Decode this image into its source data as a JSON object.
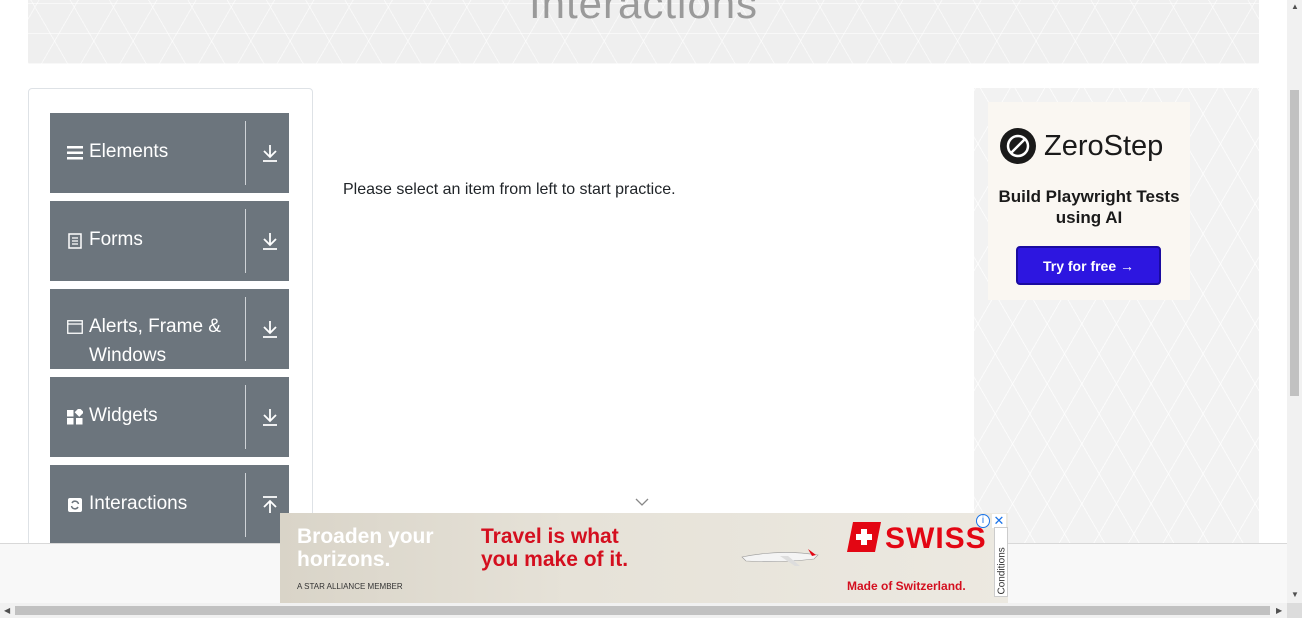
{
  "banner": {
    "title": "Interactions"
  },
  "sidebar": {
    "groups": [
      {
        "label": "Elements",
        "icon": "hamburger-icon",
        "arrow": "download"
      },
      {
        "label": "Forms",
        "icon": "document-icon",
        "arrow": "download"
      },
      {
        "label": "Alerts, Frame & Windows",
        "icon": "window-icon",
        "arrow": "download"
      },
      {
        "label": "Widgets",
        "icon": "widgets-icon",
        "arrow": "download"
      },
      {
        "label": "Interactions",
        "icon": "interactions-icon",
        "arrow": "upload"
      }
    ]
  },
  "main": {
    "message": "Please select an item from left to start practice."
  },
  "ad_right": {
    "brand": "ZeroStep",
    "tagline": "Build Playwright Tests using AI",
    "button": "Try for free →"
  },
  "ad_bottom": {
    "headline_left": "Broaden your horizons.",
    "headline_right": "Travel is what you make of it.",
    "brand": "SWISS",
    "tagline": "Made of Switzerland.",
    "member": "A STAR ALLIANCE MEMBER",
    "conditions": "Conditions"
  },
  "colors": {
    "sidebar_bg": "#6c757d",
    "ad_button": "#2d16e0",
    "swiss_red": "#e30613"
  }
}
